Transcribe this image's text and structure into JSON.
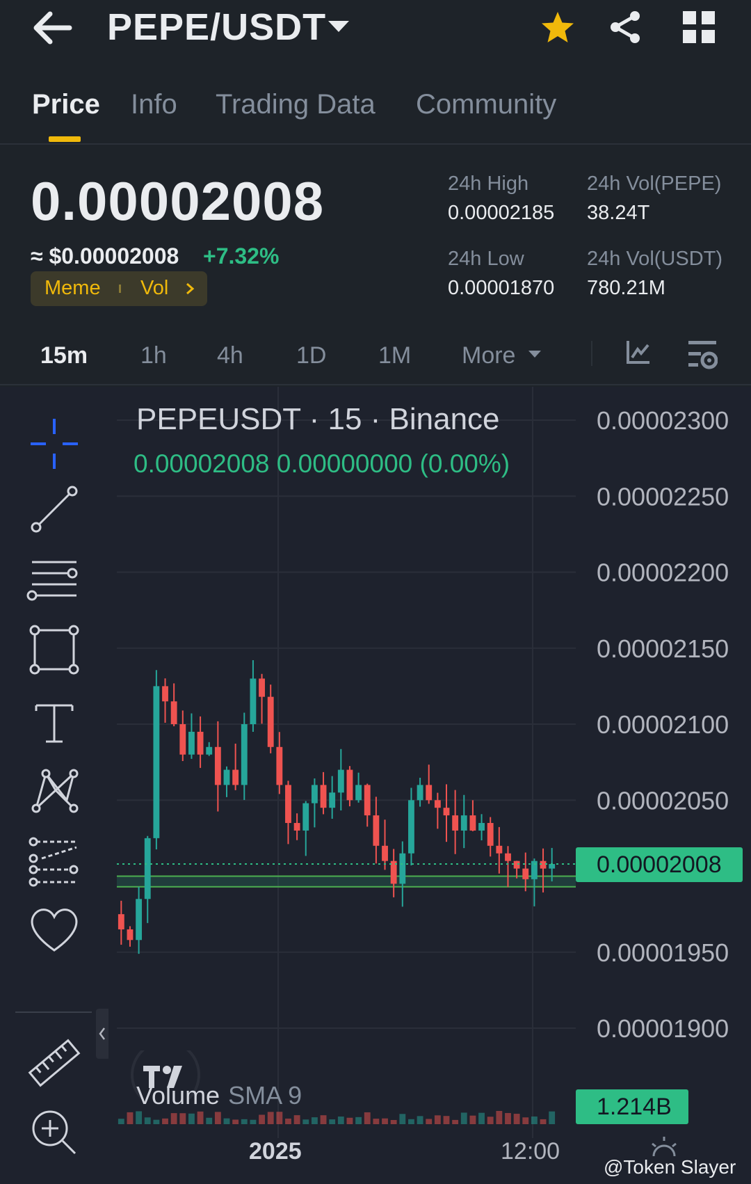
{
  "header": {
    "pair": "PEPE/USDT"
  },
  "tabs": [
    "Price",
    "Info",
    "Trading Data",
    "Community"
  ],
  "ticker": {
    "last_price": "0.00002008",
    "usd_price": "≈ $0.00002008",
    "change": "+7.32%",
    "tag_meme": "Meme",
    "tag_vol": "Vol",
    "high_label": "24h High",
    "high_value": "0.00002185",
    "low_label": "24h Low",
    "low_value": "0.00001870",
    "vol_base_label": "24h Vol(PEPE)",
    "vol_base_value": "38.24T",
    "vol_quote_label": "24h Vol(USDT)",
    "vol_quote_value": "780.21M"
  },
  "intervals": [
    "15m",
    "1h",
    "4h",
    "1D",
    "1M",
    "More"
  ],
  "chart": {
    "symbol_title": "PEPEUSDT · 15 · Binance",
    "ohlc": "0.00002008  0.00000000 (0.00%)",
    "current_price_tag": "0.00002008",
    "volume_tag": "1.214B",
    "volume_name": "Volume",
    "volume_sma": "SMA 9",
    "x_labels": [
      "2025",
      "12:00"
    ],
    "watermark": "@Token Slayer"
  },
  "chart_data": {
    "type": "candlestick",
    "y_ticks": [
      "0.00002300",
      "0.00002250",
      "0.00002200",
      "0.00002150",
      "0.00002100",
      "0.00002050",
      "0.00001950",
      "0.00001900"
    ],
    "ylim": [
      1.87e-05,
      2.31e-05
    ],
    "current_price": 2.008e-05,
    "support_band": [
      1.993e-05,
      2e-05
    ],
    "candles_close": [
      1.965e-05,
      1.958e-05,
      1.985e-05,
      2.025e-05,
      2.125e-05,
      2.115e-05,
      2.1e-05,
      2.08e-05,
      2.095e-05,
      2.08e-05,
      2.085e-05,
      2.06e-05,
      2.07e-05,
      2.06e-05,
      2.1e-05,
      2.13e-05,
      2.118e-05,
      2.085e-05,
      2.06e-05,
      2.035e-05,
      2.03e-05,
      2.048e-05,
      2.06e-05,
      2.045e-05,
      2.055e-05,
      2.07e-05,
      2.05e-05,
      2.06e-05,
      2.04e-05,
      2.02e-05,
      2.01e-05,
      1.995e-05,
      2.015e-05,
      2.05e-05,
      2.06e-05,
      2.05e-05,
      2.045e-05,
      2.04e-05,
      2.03e-05,
      2.04e-05,
      2.03e-05,
      2.035e-05,
      2.02e-05,
      2.015e-05,
      2.01e-05,
      2.005e-05,
      1.998e-05,
      2.01e-05,
      2.005e-05,
      2.008e-05
    ],
    "colors": {
      "up": "#26a69a",
      "down": "#ef5350"
    }
  },
  "colors": {
    "bg": "#1e2329",
    "chart_bg": "#1e222d",
    "accent": "#f0b90b",
    "up": "#2ebd85",
    "down": "#f6465d"
  },
  "icons": {
    "back": "arrow-left-icon",
    "star": "star-icon",
    "share": "share-icon",
    "grid": "grid-icon"
  }
}
